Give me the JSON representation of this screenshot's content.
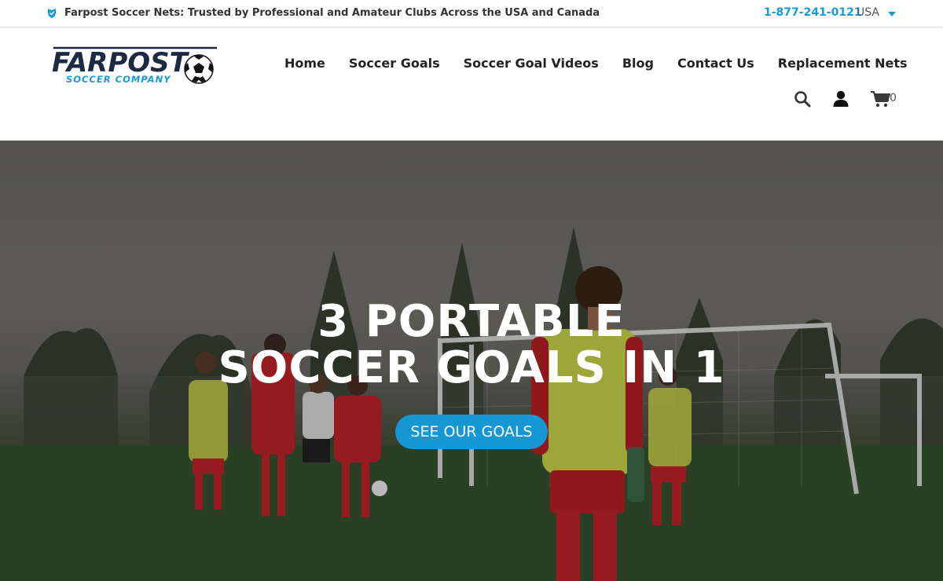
{
  "topbar": {
    "tagline": "Farpost Soccer Nets: Trusted by Professional and Amateur Clubs Across the USA and Canada",
    "phone": "1-877-241-0121",
    "country": "USA",
    "icon": "shield-check-icon"
  },
  "logo": {
    "text": "FARPOST",
    "subtext": "SOCCER COMPANY",
    "icon": "soccer-ball-icon"
  },
  "nav": {
    "items": [
      {
        "label": "Home"
      },
      {
        "label": "Soccer Goals"
      },
      {
        "label": "Soccer Goal Videos"
      },
      {
        "label": "Blog"
      },
      {
        "label": "Contact Us"
      },
      {
        "label": "Replacement Nets"
      }
    ]
  },
  "actions": {
    "search_icon": "search-icon",
    "account_icon": "user-icon",
    "cart_icon": "cart-icon",
    "cart_count": "0"
  },
  "hero": {
    "headline_line1": "3 PORTABLE",
    "headline_line2": "SOCCER GOALS IN 1",
    "cta_label": "SEE OUR GOALS"
  },
  "colors": {
    "accent": "#1597d3",
    "logo_navy": "#1d2a44",
    "logo_blue": "#1a9ad6"
  }
}
